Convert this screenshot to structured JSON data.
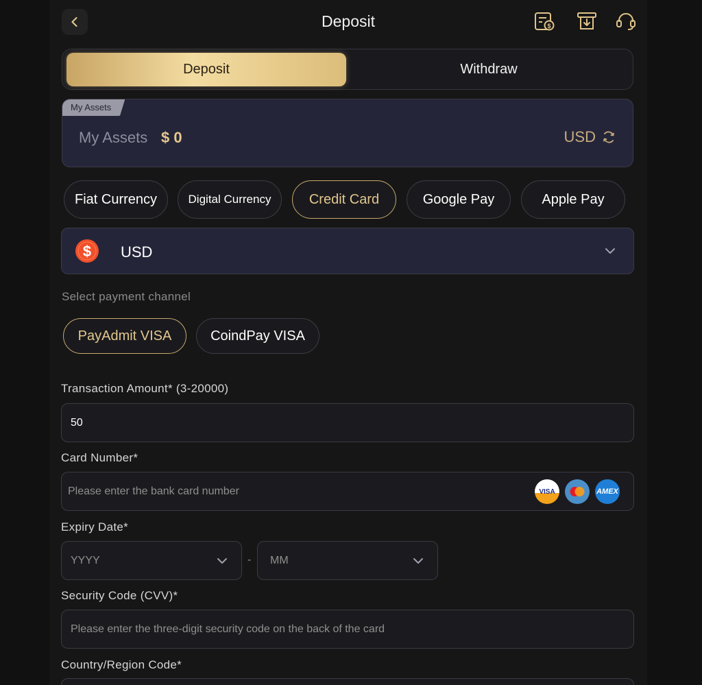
{
  "header": {
    "title": "Deposit",
    "icons": [
      "back-chevron-icon",
      "bill-dollar-icon",
      "atm-download-icon",
      "headset-icon"
    ]
  },
  "tabs": [
    {
      "label": "Deposit",
      "active": true
    },
    {
      "label": "Withdraw",
      "active": false
    }
  ],
  "assets": {
    "tag": "My Assets",
    "label": "My Assets",
    "value": "$ 0",
    "currency": "USD"
  },
  "methods": [
    {
      "label": "Fiat Currency",
      "active": false
    },
    {
      "label": "Digital Currency",
      "active": false
    },
    {
      "label": "Credit Card",
      "active": true
    },
    {
      "label": "Google Pay",
      "active": false
    },
    {
      "label": "Apple Pay",
      "active": false
    }
  ],
  "currency_select": {
    "value": "USD",
    "icon": "dollar-coin-icon"
  },
  "payment_channel": {
    "label": "Select payment channel",
    "options": [
      {
        "label": "PayAdmit VISA",
        "active": true
      },
      {
        "label": "CoindPay VISA",
        "active": false
      }
    ]
  },
  "form": {
    "amount": {
      "label": "Transaction Amount* (3-20000)",
      "value": "50"
    },
    "card_number": {
      "label": "Card Number*",
      "placeholder": "Please enter the bank card number",
      "logos": [
        "VISA",
        "MasterCard",
        "AMEX"
      ]
    },
    "expiry": {
      "label": "Expiry Date*",
      "year_placeholder": "YYYY",
      "month_placeholder": "MM",
      "separator": "-"
    },
    "cvv": {
      "label": "Security Code (CVV)*",
      "placeholder": "Please enter the three-digit security code on the back of the card"
    },
    "country": {
      "label": "Country/Region Code*"
    }
  },
  "colors": {
    "accent_gold": "#e3c78e",
    "background": "#161616",
    "card_bg": "#25253a"
  }
}
